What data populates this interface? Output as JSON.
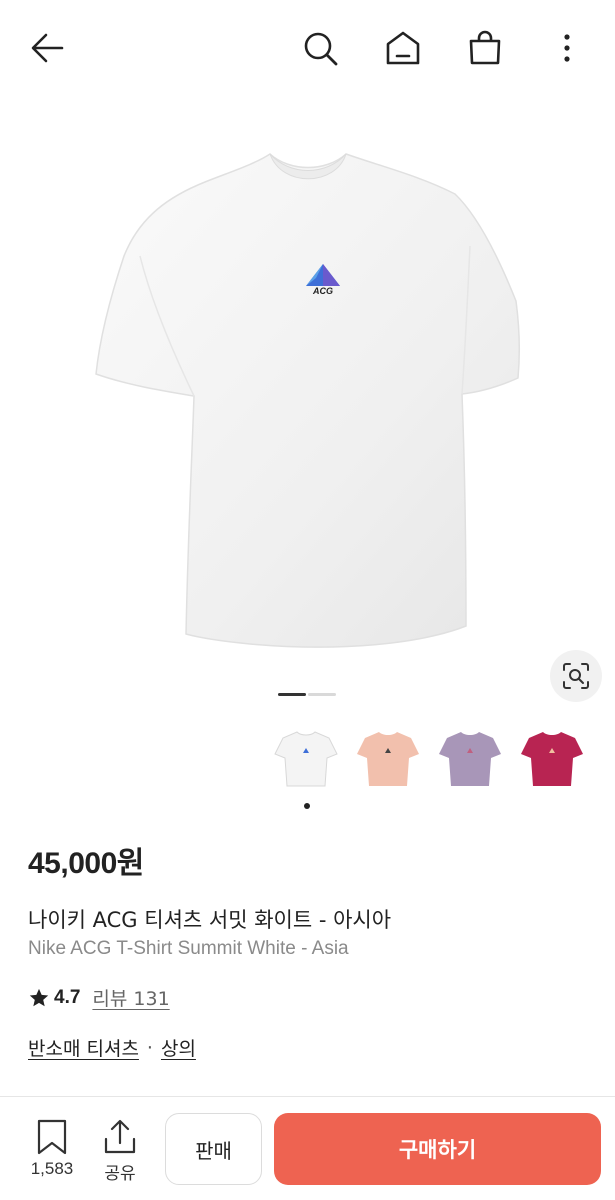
{
  "header": {
    "back_icon": "arrow-left-icon",
    "search_icon": "search-icon",
    "home_icon": "home-icon",
    "bag_icon": "shopping-bag-icon",
    "more_icon": "more-vertical-icon"
  },
  "gallery": {
    "current_index": 1,
    "total": 2,
    "logo_text": "ACG",
    "lens_icon": "lens-search-icon",
    "thumbnails": [
      {
        "color": "#f4f4f4",
        "label": "white"
      },
      {
        "color": "#f2c0ad",
        "label": "pink"
      },
      {
        "color": "#a896b8",
        "label": "purple"
      },
      {
        "color": "#b82452",
        "label": "magenta"
      }
    ],
    "selected_thumbnail": 0
  },
  "product": {
    "price": "45,000원",
    "title_ko": "나이키 ACG 티셔츠 서밋 화이트 - 아시아",
    "title_en": "Nike ACG T-Shirt Summit White - Asia",
    "rating": "4.7",
    "reviews": "리뷰 131",
    "categories": [
      "반소매 티셔츠",
      "상의"
    ],
    "category_separator": "·"
  },
  "actions": {
    "save_count": "1,583",
    "share_label": "공유",
    "sell_label": "판매",
    "buy_label": "구매하기",
    "buy_color": "#ee6351"
  }
}
